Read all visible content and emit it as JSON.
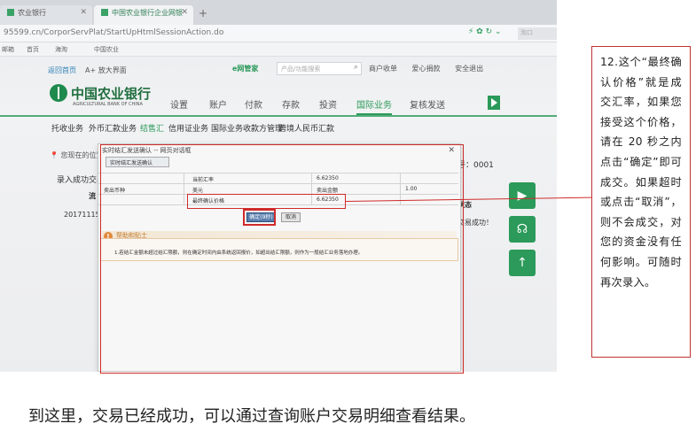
{
  "browser": {
    "tab1": "农业银行",
    "tab2": "中国农业银行企业网银",
    "url": "95599.cn/CorporServPlat/StartUpHtmlSessionAction.do",
    "bookmarks": [
      "邮箱",
      "首页",
      "海淘",
      "中国农业"
    ],
    "search_placeholder": "淘口",
    "accent": "#2b9a5a"
  },
  "site": {
    "home_link": "返回首页",
    "large_font": "A+ 放大界面",
    "ebank_label": "e网管家",
    "search_placeholder": "产品/功能搜索",
    "toplinks": [
      "商户收单",
      "爱心捐款",
      "安全退出"
    ],
    "logo_cn": "中国农业银行",
    "logo_en": "AGRICULTURAL BANK OF CHINA",
    "mainnav": [
      "设置",
      "账户",
      "付款",
      "存款",
      "投资",
      "国际业务",
      "复核发送"
    ],
    "mainnav_active": "国际业务",
    "subnav": [
      "托收业务",
      "外币汇款业务",
      "结售汇",
      "信用证业务",
      "国际业务收款方管理",
      "跨境人民币汇款"
    ],
    "subnav_active": "结售汇",
    "location": "您现在的位置",
    "record_success": "录入成功交易",
    "serial": "号：0001",
    "col_serial": "流",
    "col_status": "状态",
    "row_date": "20171115",
    "row_status": "交易成功！"
  },
  "dialog": {
    "title": "实时结汇发送确认 -- 网页对话框",
    "tab": "实时结汇发送确认",
    "rows": {
      "current_rate_label": "当前汇率",
      "current_rate": "6.62350",
      "sell_currency_label": "卖出币种",
      "sell_currency": "美元",
      "sell_amount_label": "卖出金额",
      "sell_amount": "1.00",
      "final_rate_label": "最终确认价格",
      "final_rate": "6.62350"
    },
    "confirm_button": "确定(9秒)",
    "cancel_button": "取消",
    "help_title": "帮助和贴士",
    "help_text": "1.若结汇金额未超过结汇限额，则在确定时间内由系统返回报价，如超出结汇限额，则作为一般结汇业务落地办理。"
  },
  "annotation": {
    "text": "12.这个“最终确认价格”就是成交汇率，如果您接受这个价格，请在 20 秒之内点击“确定”即可成交。如果超时或点击“取消”，则不会成交，对您的资金没有任何影响。可随时再次录入。",
    "color": "#d02b2b"
  },
  "caption": "到这里，交易已经成功，可以通过查询账户交易明细查看结果。"
}
